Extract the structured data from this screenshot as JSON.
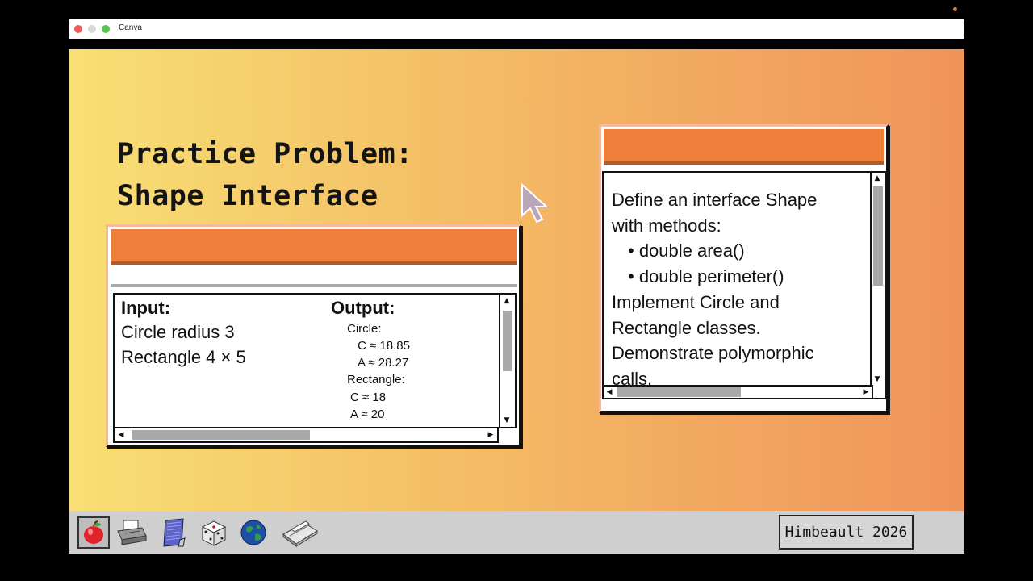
{
  "window": {
    "title": "Canva"
  },
  "slide": {
    "title_line1": "Practice Problem:",
    "title_line2": "Shape Interface"
  },
  "io_window": {
    "input_heading": "Input:",
    "input_lines": [
      "Circle radius 3",
      "Rectangle 4 × 5"
    ],
    "output_heading": "Output:",
    "output_lines": [
      "Circle:",
      "C ≈ 18.85",
      "A ≈ 28.27",
      "Rectangle:",
      "C ≈ 18",
      "A ≈ 20"
    ]
  },
  "task_window": {
    "lines": [
      "Define an interface Shape",
      "with methods:",
      "• double area()",
      "• double perimeter()",
      "Implement Circle and",
      "Rectangle classes.",
      "Demonstrate polymorphic",
      "calls."
    ]
  },
  "taskbar": {
    "icons": [
      "apple-icon",
      "printer-icon",
      "notepad-icon",
      "dice-icon",
      "globe-icon",
      "scanner-icon"
    ],
    "credit": "Himbeault 2026"
  },
  "colors": {
    "accent": "#ee7f3b",
    "gradient_start": "#f8df74",
    "gradient_end": "#ef945a"
  }
}
